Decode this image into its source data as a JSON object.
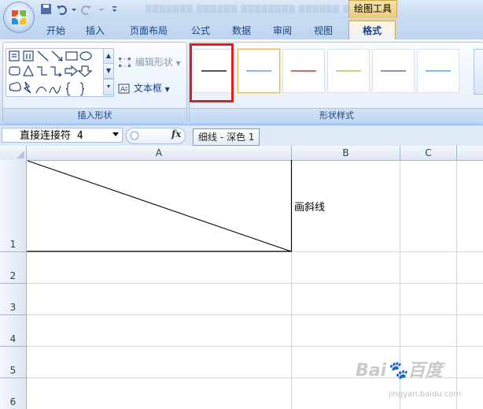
{
  "title_bar": {
    "contextual_tab_group": "绘图工具"
  },
  "tabs": [
    "开始",
    "插入",
    "页面布局",
    "公式",
    "数据",
    "审阅",
    "视图",
    "格式"
  ],
  "ribbon": {
    "insert_shapes": {
      "edit_shape_label": "编辑形状",
      "textbox_label": "文本框",
      "group_label": "插入形状"
    },
    "shape_styles": {
      "group_label": "形状样式",
      "styles": [
        {
          "line_color": "#555555"
        },
        {
          "line_color": "#8db4e2"
        },
        {
          "line_color": "#e06666"
        },
        {
          "line_color": "#c4d67d"
        },
        {
          "line_color": "#9b8bb8"
        },
        {
          "line_color": "#7fc4d8"
        },
        {
          "line_color": "#f0a860"
        }
      ]
    }
  },
  "formula_bar": {
    "name_box": "直接连接符 4",
    "fx_label": "fx",
    "tooltip": "细线 - 深色 1"
  },
  "sheet": {
    "columns": [
      "A",
      "B",
      "C"
    ],
    "rows": [
      "1",
      "2",
      "3",
      "4",
      "5",
      "6"
    ],
    "cell_b1": "画斜线"
  },
  "watermark": {
    "brand": "Bai🐾百度",
    "url": "jingyan.baidu.com"
  },
  "colors": {
    "highlight_box": "#e21b1b",
    "tab_text": "#15428b"
  }
}
